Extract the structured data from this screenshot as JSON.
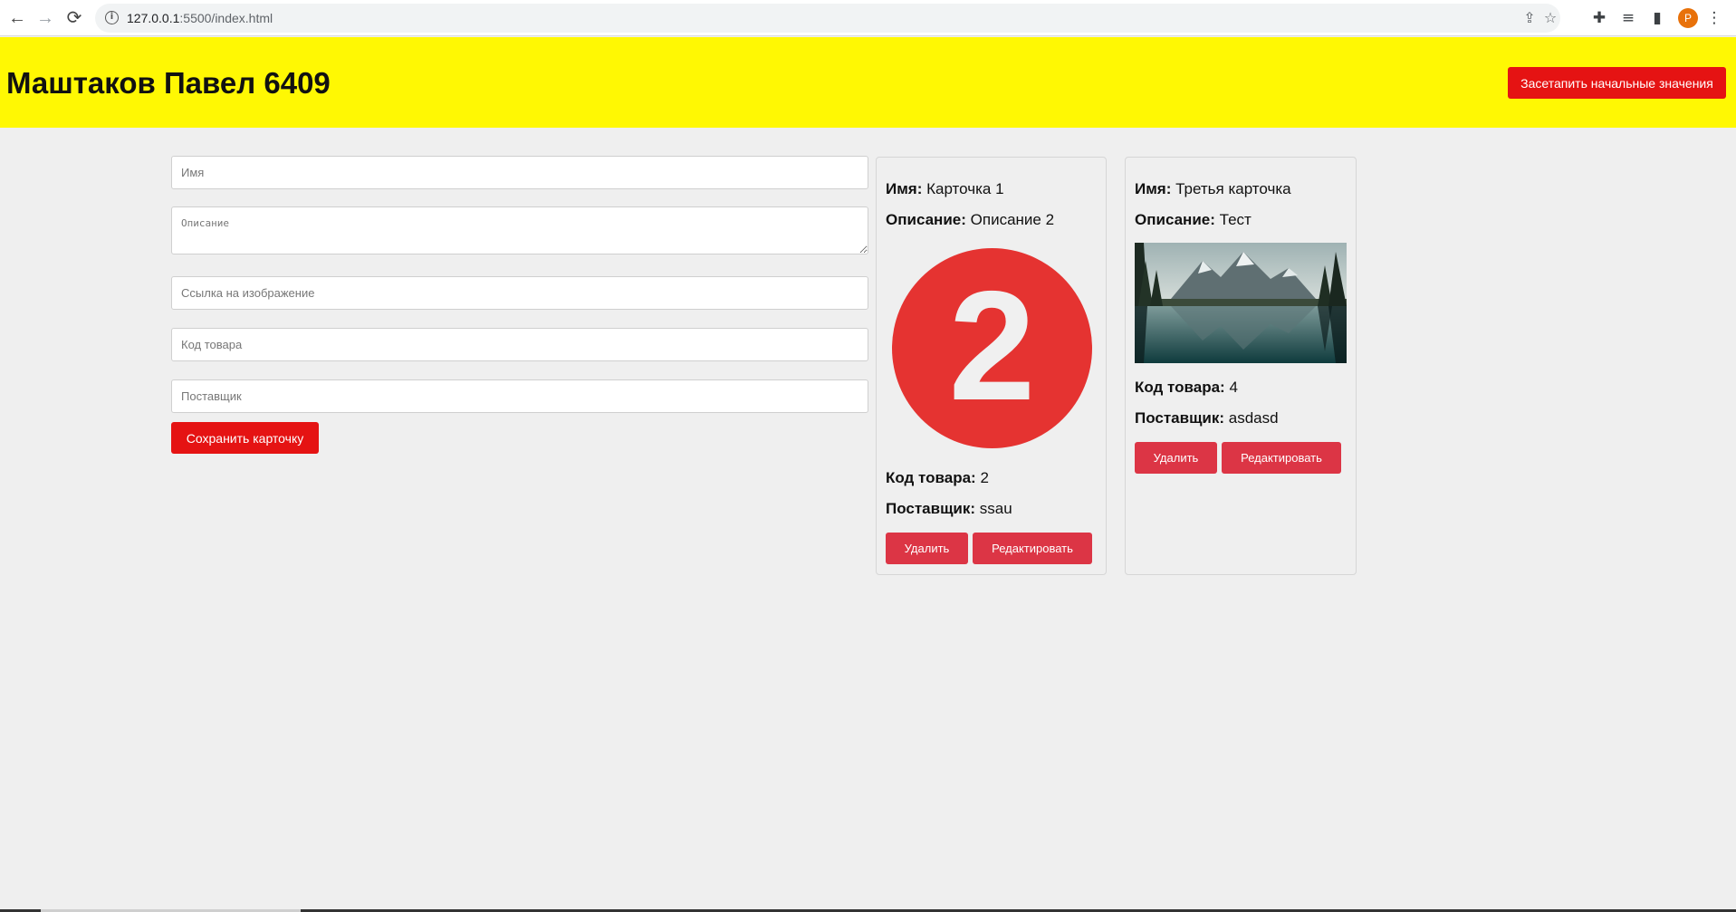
{
  "browser": {
    "url_host": "127.0.0.1",
    "url_rest": ":5500/index.html",
    "avatar_letter": "P"
  },
  "header": {
    "title": "Маштаков Павел 6409",
    "seed_button": "Засетапить начальные значения",
    "background": "#fff803",
    "accent": "#e51313"
  },
  "form": {
    "name_placeholder": "Имя",
    "description_placeholder": "Описание",
    "image_placeholder": "Ссылка на изображение",
    "code_placeholder": "Код товара",
    "supplier_placeholder": "Поставщик",
    "save_button": "Сохранить карточку"
  },
  "labels": {
    "name": "Имя:",
    "description": "Описание:",
    "code": "Код товара:",
    "supplier": "Поставщик:",
    "delete": "Удалить",
    "edit": "Редактировать"
  },
  "cards": [
    {
      "name": "Карточка 1",
      "description": "Описание 2",
      "image_text": "2",
      "code": "2",
      "supplier": "ssau"
    },
    {
      "name": "Третья карточка",
      "description": "Тест",
      "image_alt": "mountain lake landscape",
      "code": "4",
      "supplier": "asdasd"
    }
  ],
  "colors": {
    "card_button": "#dc3545",
    "page_background": "#efefef"
  }
}
